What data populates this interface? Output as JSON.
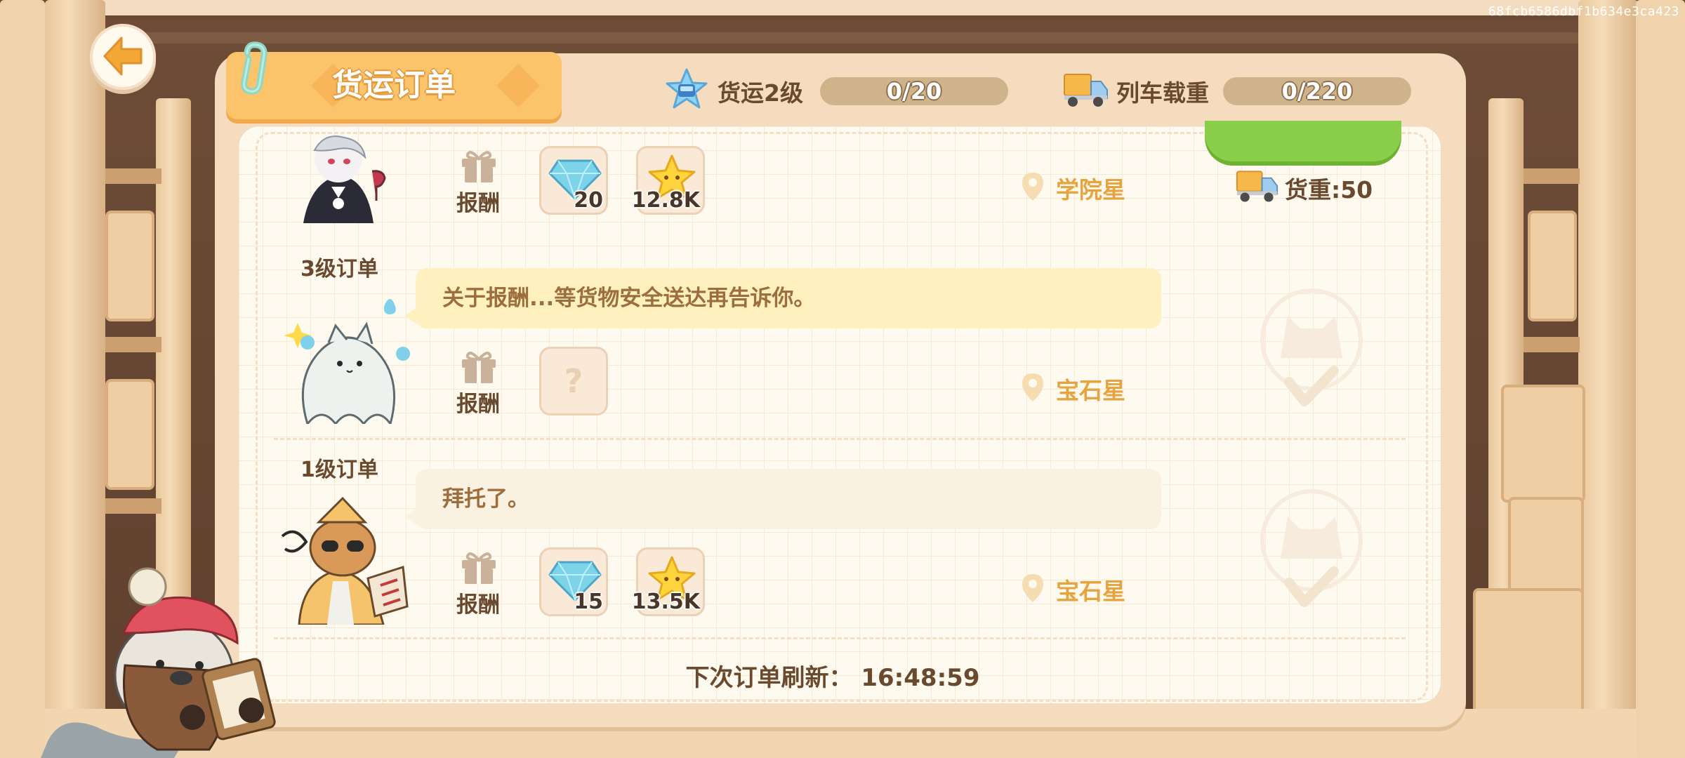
{
  "watermark": "68fcb6586dbf1b634e3ca423",
  "title": "货运订单",
  "header": {
    "freight_level_label": "货运2级",
    "freight_progress": "0/20",
    "freight_progress_fraction": 0,
    "train_load_label": "列车载重",
    "train_load_value": "0/220",
    "train_load_fraction": 0
  },
  "orders": [
    {
      "level": "",
      "message": "",
      "reward_label": "报酬",
      "rewards": [
        {
          "icon": "diamond-icon",
          "amount": "20"
        },
        {
          "icon": "star-coin-icon",
          "amount": "12.8K"
        }
      ],
      "destination": "学院星",
      "weight": "货重:50",
      "status": "deliverable"
    },
    {
      "level": "3级订单",
      "message": "关于报酬...等货物安全送达再告诉你。",
      "reward_label": "报酬",
      "rewards": [
        {
          "icon": "unknown-reward-icon",
          "amount": "?"
        }
      ],
      "destination": "宝石星",
      "status": "pending"
    },
    {
      "level": "1级订单",
      "message": "拜托了。",
      "reward_label": "报酬",
      "rewards": [
        {
          "icon": "diamond-icon",
          "amount": "15"
        },
        {
          "icon": "star-coin-icon",
          "amount": "13.5K"
        }
      ],
      "destination": "宝石星",
      "status": "pending"
    }
  ],
  "refresh": {
    "label": "下次订单刷新：",
    "time": "16:48:59"
  },
  "colors": {
    "panel": "#f5dcbe",
    "title_tab": "#fbc46a",
    "accent_orange": "#e6a33e",
    "text_brown": "#6a4a2e",
    "bubble_highlight": "#fff0bf",
    "deliver_green": "#89cf4a"
  }
}
